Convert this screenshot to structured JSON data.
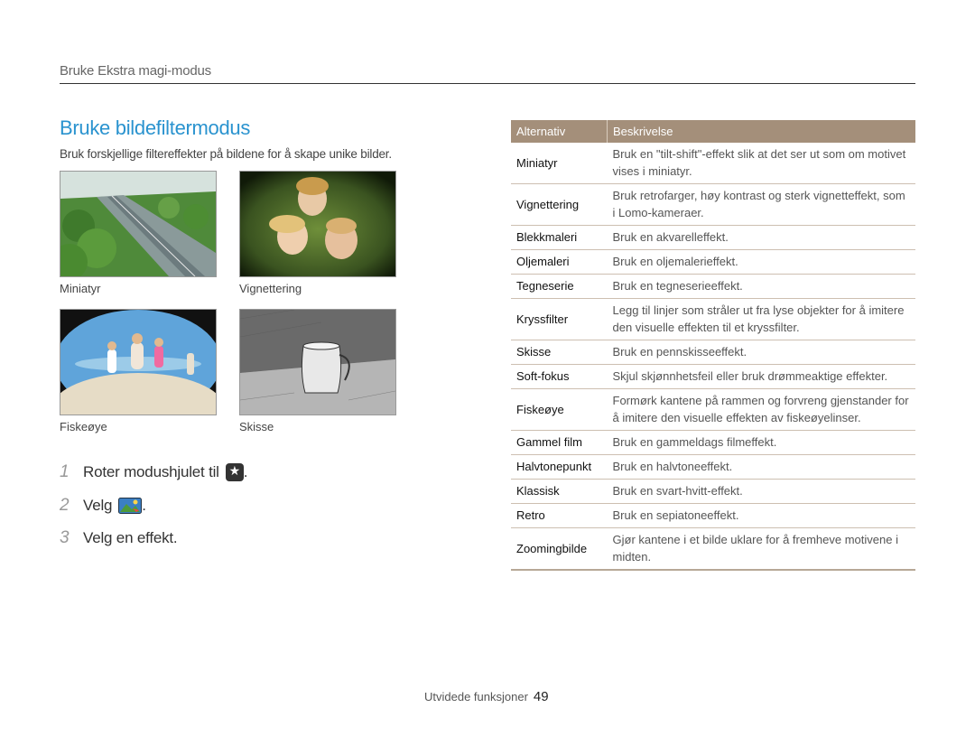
{
  "header": {
    "section": "Bruke Ekstra magi-modus"
  },
  "title": "Bruke bildefiltermodus",
  "intro": "Bruk forskjellige filtereffekter på bildene for å skape unike bilder.",
  "photos": [
    {
      "caption": "Miniatyr"
    },
    {
      "caption": "Vignettering"
    },
    {
      "caption": "Fiskeøye"
    },
    {
      "caption": "Skisse"
    }
  ],
  "steps": [
    {
      "num": "1",
      "text": "Roter modushjulet til",
      "suffix": ".",
      "icon": "magic-star-icon"
    },
    {
      "num": "2",
      "text": "Velg",
      "suffix": ".",
      "icon": "photo-filter-icon"
    },
    {
      "num": "3",
      "text": "Velg en effekt."
    }
  ],
  "table": {
    "headers": [
      "Alternativ",
      "Beskrivelse"
    ],
    "rows": [
      {
        "option": "Miniatyr",
        "description": "Bruk en \"tilt-shift\"-effekt slik at det ser ut som om motivet vises i miniatyr."
      },
      {
        "option": "Vignettering",
        "description": "Bruk retrofarger, høy kontrast og sterk vignetteffekt, som i Lomo-kameraer."
      },
      {
        "option": "Blekkmaleri",
        "description": "Bruk en akvarelleffekt."
      },
      {
        "option": "Oljemaleri",
        "description": "Bruk en oljemalerieffekt."
      },
      {
        "option": "Tegneserie",
        "description": "Bruk en tegneserieeffekt."
      },
      {
        "option": "Kryssfilter",
        "description": "Legg til linjer som stråler ut fra lyse objekter for å imitere den visuelle effekten til et kryssfilter."
      },
      {
        "option": "Skisse",
        "description": "Bruk en pennskisseeffekt."
      },
      {
        "option": "Soft-fokus",
        "description": "Skjul skjønnhetsfeil eller bruk drømmeaktige effekter."
      },
      {
        "option": "Fiskeøye",
        "description": "Formørk kantene på rammen og forvreng gjenstander for å imitere den visuelle effekten av fiskeøyelinser."
      },
      {
        "option": "Gammel film",
        "description": "Bruk en gammeldags filmeffekt."
      },
      {
        "option": "Halvtonepunkt",
        "description": "Bruk en halvtoneeffekt."
      },
      {
        "option": "Klassisk",
        "description": "Bruk en svart-hvitt-effekt."
      },
      {
        "option": "Retro",
        "description": "Bruk en sepiatoneeffekt."
      },
      {
        "option": "Zoomingbilde",
        "description": "Gjør kantene i et bilde uklare for å fremheve motivene i midten."
      }
    ]
  },
  "footer": {
    "label": "Utvidede funksjoner",
    "page": "49"
  },
  "colors": {
    "title": "#2a93cf",
    "table_header": "#a48f7a",
    "rule": "#333333"
  }
}
